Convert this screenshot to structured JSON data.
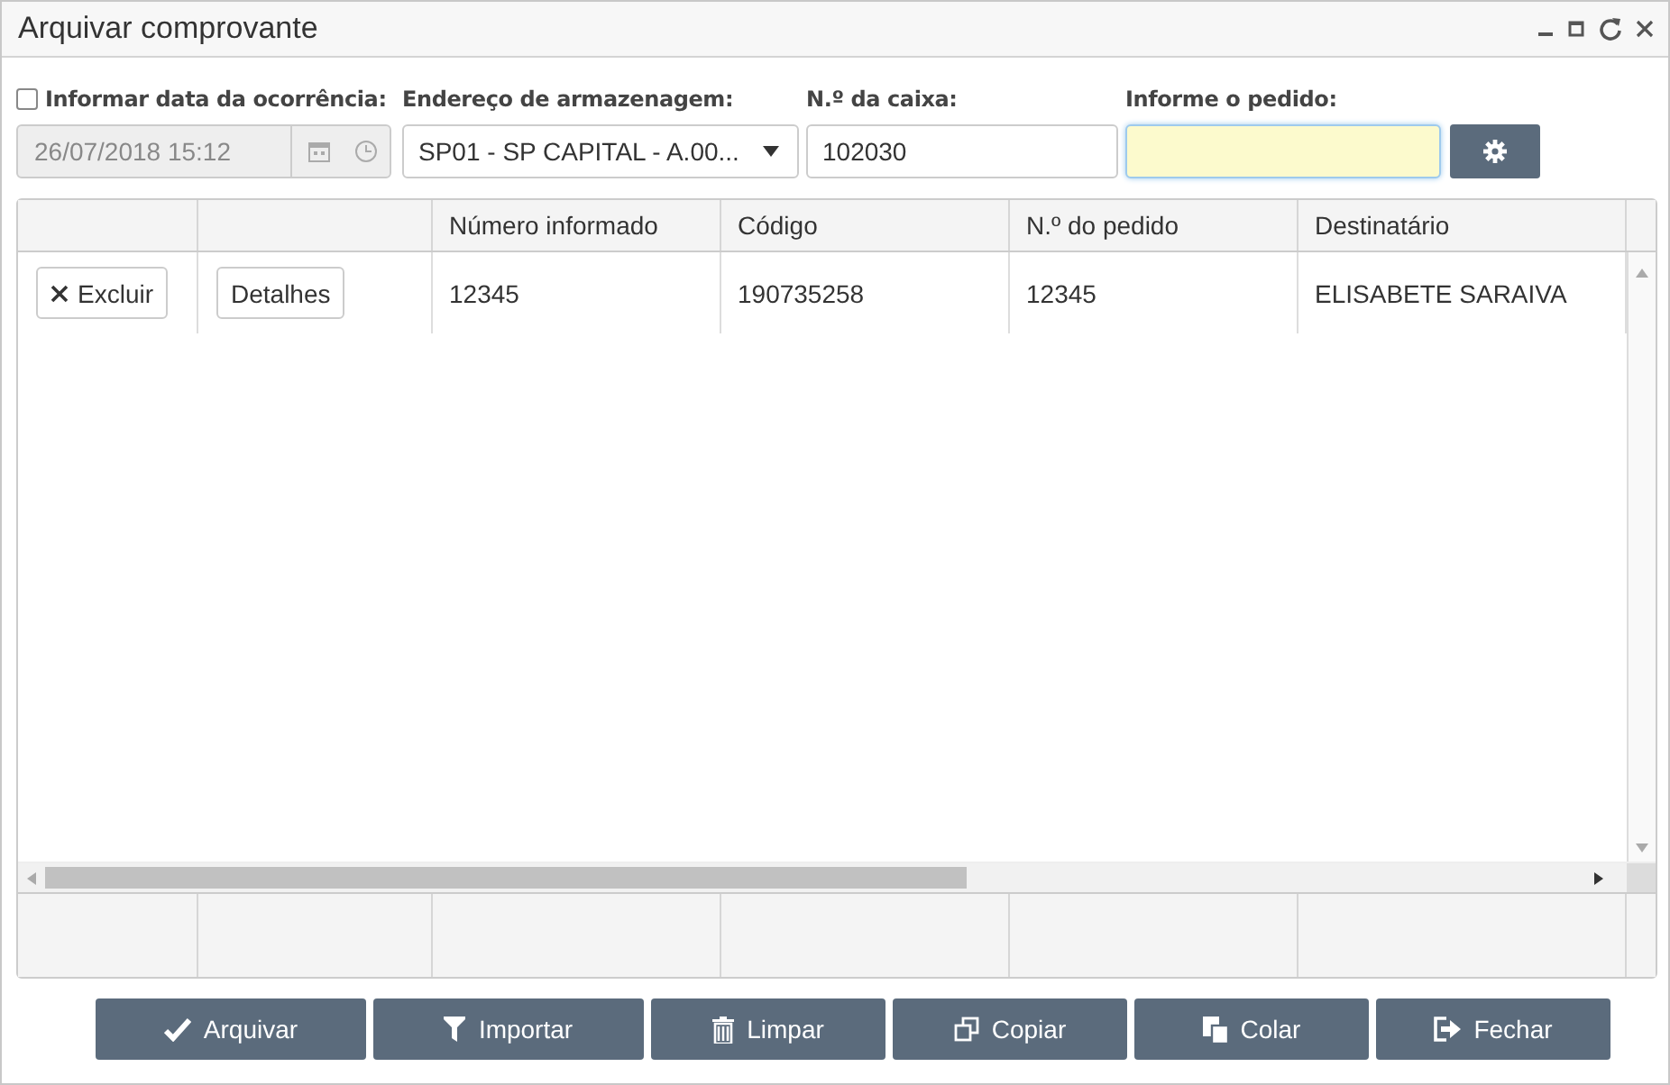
{
  "window": {
    "title": "Arquivar comprovante"
  },
  "form": {
    "date_toggle": {
      "label": "Informar data da ocorrência:",
      "checked": false
    },
    "date_field": {
      "value": "26/07/2018 15:12",
      "disabled": true
    },
    "address": {
      "label": "Endereço de armazenagem:",
      "value": "SP01 - SP CAPITAL - A.00..."
    },
    "box": {
      "label": "N.º da caixa:",
      "value": "102030"
    },
    "order": {
      "label": "Informe o pedido:"
    }
  },
  "table": {
    "columns": [
      "Número informado",
      "Código",
      "N.º do pedido",
      "Destinatário"
    ],
    "rows": [
      {
        "actions": [
          "Excluir",
          "Detalhes"
        ],
        "cells": [
          "12345",
          "190735258",
          "12345",
          "ELISABETE SARAIVA"
        ]
      }
    ]
  },
  "buttons": [
    {
      "kind": "check",
      "label": "Arquivar"
    },
    {
      "kind": "filter",
      "label": "Importar"
    },
    {
      "kind": "trash",
      "label": "Limpar"
    },
    {
      "kind": "copy",
      "label": "Copiar"
    },
    {
      "kind": "paste",
      "label": "Colar"
    },
    {
      "kind": "exit",
      "label": "Fechar"
    }
  ]
}
